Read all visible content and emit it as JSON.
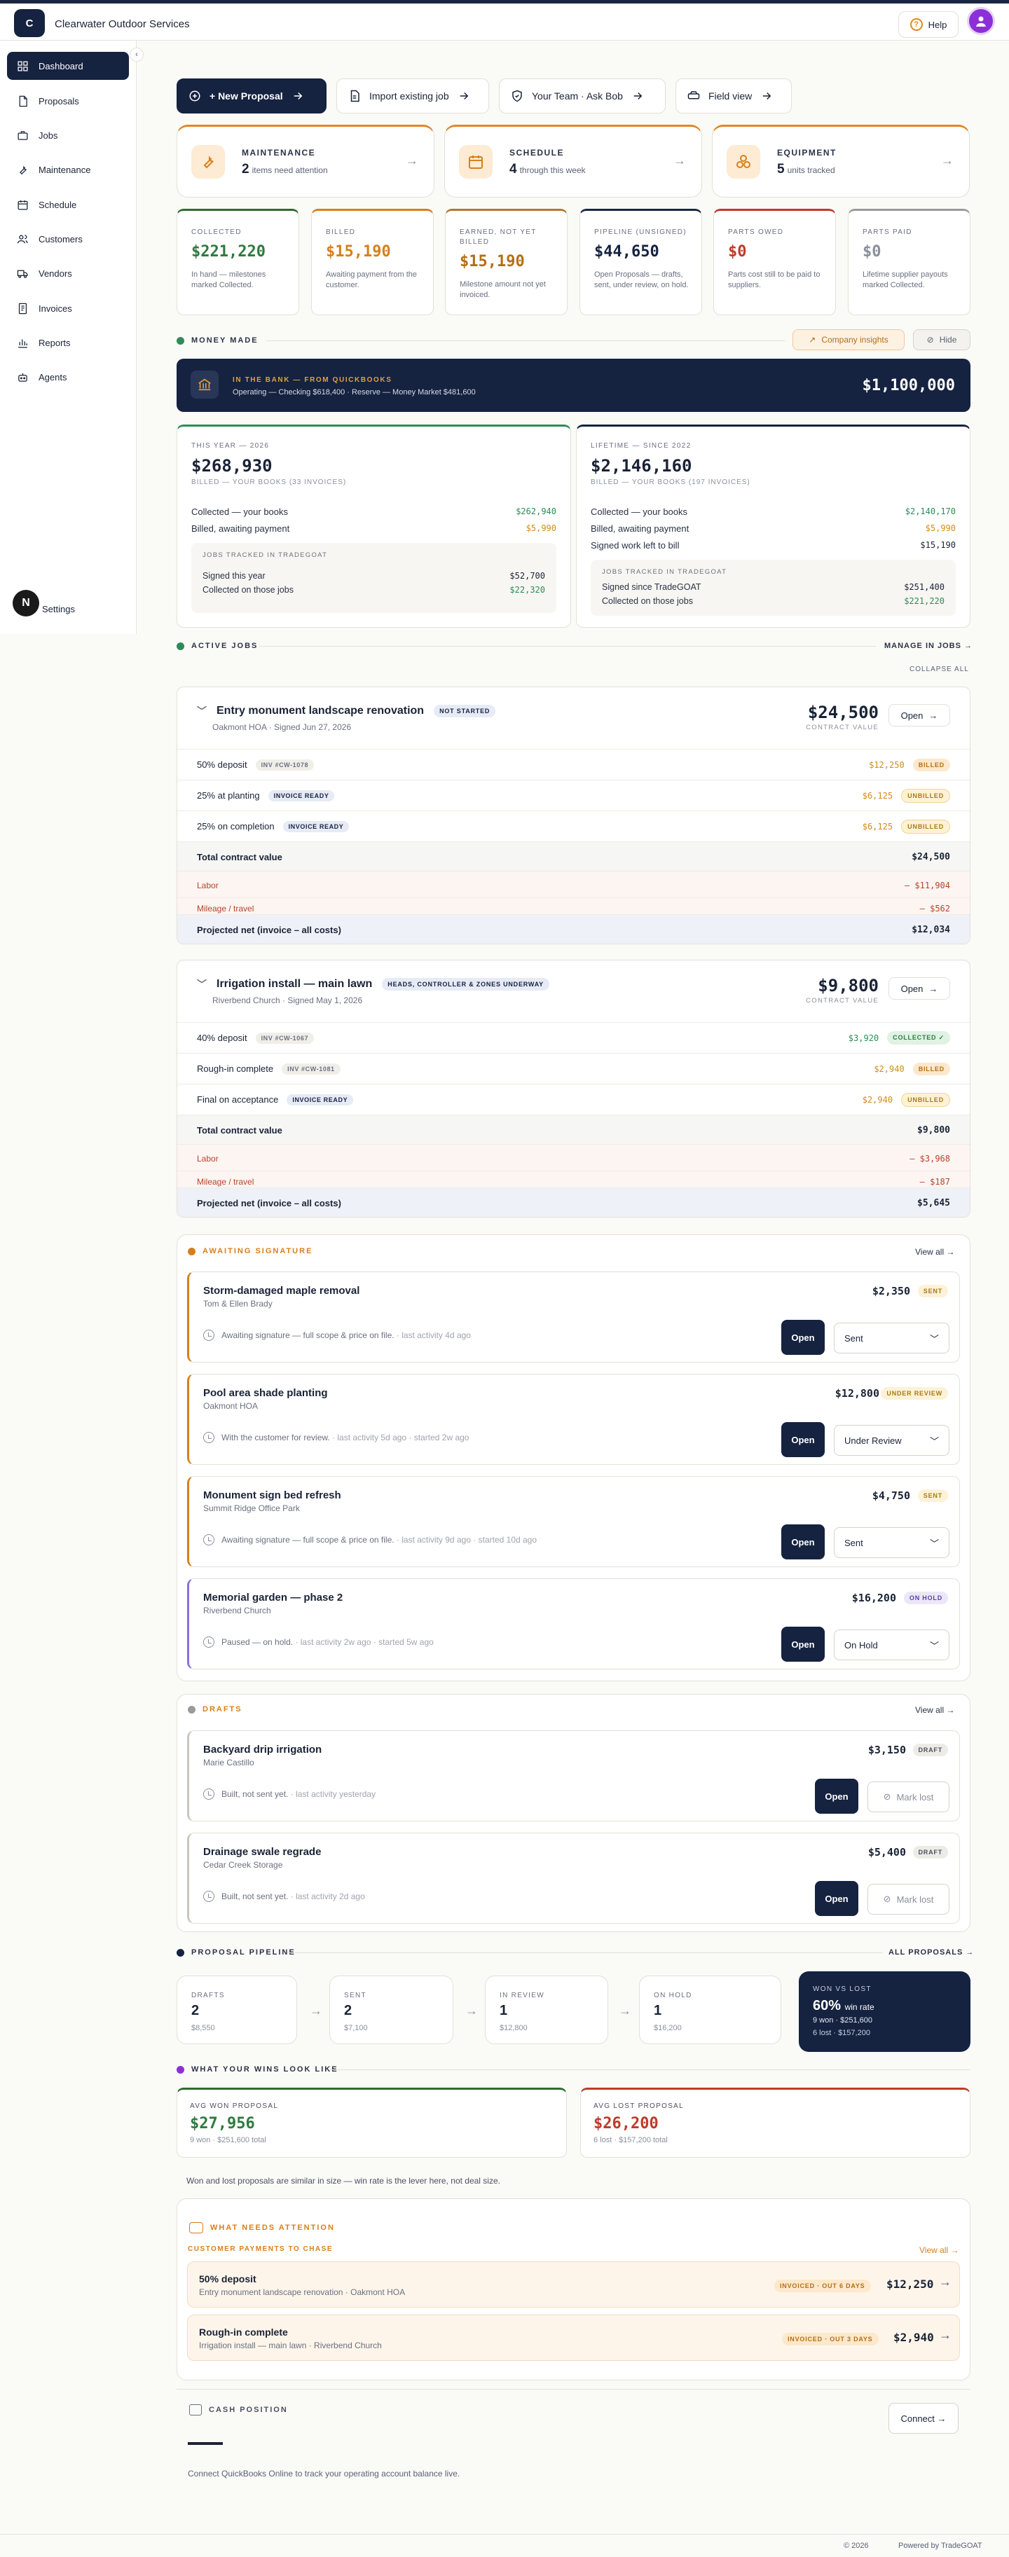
{
  "app": {
    "brand": "Clearwater Outdoor Services",
    "logo_letter": "C",
    "help": "Help"
  },
  "sidebar": {
    "items": [
      {
        "label": "Dashboard"
      },
      {
        "label": "Proposals"
      },
      {
        "label": "Jobs"
      },
      {
        "label": "Maintenance"
      },
      {
        "label": "Schedule"
      },
      {
        "label": "Customers"
      },
      {
        "label": "Vendors"
      },
      {
        "label": "Invoices"
      },
      {
        "label": "Reports"
      },
      {
        "label": "Agents"
      }
    ],
    "badge": "N",
    "settings": "Settings"
  },
  "actions": {
    "new_proposal": "+ New Proposal",
    "import": "Import existing job",
    "team": "Your Team · Ask Bob",
    "field": "Field view"
  },
  "tiles": [
    {
      "label": "MAINTENANCE",
      "value": "2",
      "desc": "items need attention"
    },
    {
      "label": "SCHEDULE",
      "value": "4",
      "desc": "through this week"
    },
    {
      "label": "EQUIPMENT",
      "value": "5",
      "desc": "units tracked"
    }
  ],
  "kpis": [
    {
      "label": "COLLECTED",
      "value": "$221,220",
      "desc": "In hand — milestones marked Collected."
    },
    {
      "label": "BILLED",
      "value": "$15,190",
      "desc": "Awaiting payment from the customer."
    },
    {
      "label": "EARNED, NOT YET BILLED",
      "value": "$15,190",
      "desc": "Milestone amount not yet invoiced."
    },
    {
      "label": "PIPELINE (UNSIGNED)",
      "value": "$44,650",
      "desc": "Open Proposals — drafts, sent, under review, on hold."
    },
    {
      "label": "PARTS OWED",
      "value": "$0",
      "desc": "Parts cost still to be paid to suppliers."
    },
    {
      "label": "PARTS PAID",
      "value": "$0",
      "desc": "Lifetime supplier payouts marked Collected."
    }
  ],
  "money": {
    "title": "MONEY MADE",
    "insights": "Company insights",
    "hide": "Hide",
    "bank_label": "IN THE BANK — FROM QUICKBOOKS",
    "bank_detail": "Operating — Checking $618,400 · Reserve — Money Market $481,600",
    "bank_total": "$1,100,000",
    "year": {
      "label": "THIS YEAR — 2026",
      "value": "$268,930",
      "sub": "BILLED — YOUR BOOKS (33 INVOICES)",
      "r1l": "Collected — your books",
      "r1v": "$262,940",
      "r2l": "Billed, awaiting payment",
      "r2v": "$5,990",
      "box_label": "JOBS TRACKED IN TRADEGOAT",
      "b1l": "Signed this year",
      "b1v": "$52,700",
      "b2l": "Collected on those jobs",
      "b2v": "$22,320"
    },
    "life": {
      "label": "LIFETIME — SINCE 2022",
      "value": "$2,146,160",
      "sub": "BILLED — YOUR BOOKS (197 INVOICES)",
      "r1l": "Collected — your books",
      "r1v": "$2,140,170",
      "r2l": "Billed, awaiting payment",
      "r2v": "$5,990",
      "r3l": "Signed work left to bill",
      "r3v": "$15,190",
      "box_label": "JOBS TRACKED IN TRADEGOAT",
      "b1l": "Signed since TradeGOAT",
      "b1v": "$251,400",
      "b2l": "Collected on those jobs",
      "b2v": "$221,220"
    }
  },
  "active": {
    "title": "ACTIVE JOBS",
    "manage": "MANAGE IN JOBS →",
    "collapse": "COLLAPSE ALL"
  },
  "jobs": [
    {
      "title": "Entry monument landscape renovation",
      "status": "NOT STARTED",
      "meta": "Oakmont HOA · Signed Jun 27, 2026",
      "amount": "$24,500",
      "amount_label": "CONTRACT VALUE",
      "open": "Open",
      "rows": [
        {
          "label": "50% deposit",
          "tag": "INV #CW-1078",
          "value": "$12,250",
          "pill": "BILLED"
        },
        {
          "label": "25% at planting",
          "tag": "INVOICE READY",
          "value": "$6,125",
          "pill": "UNBILLED"
        },
        {
          "label": "25% on completion",
          "tag": "INVOICE READY",
          "value": "$6,125",
          "pill": "UNBILLED"
        }
      ],
      "total_label": "Total contract value",
      "total": "$24,500",
      "labor_label": "Labor",
      "labor": "– $11,904",
      "mileage_label": "Mileage / travel",
      "mileage": "– $562",
      "net_label": "Projected net (invoice – all costs)",
      "net": "$12,034"
    },
    {
      "title": "Irrigation install — main lawn",
      "status": "HEADS, CONTROLLER & ZONES UNDERWAY",
      "meta": "Riverbend Church · Signed May 1, 2026",
      "amount": "$9,800",
      "amount_label": "CONTRACT VALUE",
      "open": "Open",
      "rows": [
        {
          "label": "40% deposit",
          "tag": "INV #CW-1067",
          "value": "$3,920",
          "pill": "COLLECTED ✓"
        },
        {
          "label": "Rough-in complete",
          "tag": "INV #CW-1081",
          "value": "$2,940",
          "pill": "BILLED"
        },
        {
          "label": "Final on acceptance",
          "tag": "INVOICE READY",
          "value": "$2,940",
          "pill": "UNBILLED"
        }
      ],
      "total_label": "Total contract value",
      "total": "$9,800",
      "labor_label": "Labor",
      "labor": "– $3,968",
      "mileage_label": "Mileage / travel",
      "mileage": "– $187",
      "net_label": "Projected net (invoice – all costs)",
      "net": "$5,645"
    }
  ],
  "awaiting": {
    "title": "AWAITING SIGNATURE",
    "view_all": "View all →",
    "cards": [
      {
        "title": "Storm-damaged maple removal",
        "client": "Tom & Ellen Brady",
        "meta": "Awaiting signature — full scope & price on file.",
        "activity": " · last activity 4d ago",
        "amount": "$2,350",
        "pill": "SENT",
        "open": "Open",
        "select": "Sent"
      },
      {
        "title": "Pool area shade planting",
        "client": "Oakmont HOA",
        "meta": "With the customer for review.",
        "activity": " · last activity 5d ago · started 2w ago",
        "amount": "$12,800",
        "pill": "UNDER REVIEW",
        "open": "Open",
        "select": "Under Review"
      },
      {
        "title": "Monument sign bed refresh",
        "client": "Summit Ridge Office Park",
        "meta": "Awaiting signature — full scope & price on file.",
        "activity": " · last activity 9d ago · started 10d ago",
        "amount": "$4,750",
        "pill": "SENT",
        "open": "Open",
        "select": "Sent"
      },
      {
        "title": "Memorial garden — phase 2",
        "client": "Riverbend Church",
        "meta": "Paused — on hold.",
        "activity": " · last activity 2w ago · started 5w ago",
        "amount": "$16,200",
        "pill": "ON HOLD",
        "open": "Open",
        "select": "On Hold"
      }
    ]
  },
  "drafts": {
    "title": "DRAFTS",
    "view_all": "View all →",
    "cards": [
      {
        "title": "Backyard drip irrigation",
        "client": "Marie Castillo",
        "meta": "Built, not sent yet.",
        "activity": " · last activity yesterday",
        "amount": "$3,150",
        "pill": "DRAFT",
        "open": "Open",
        "lost": "Mark lost"
      },
      {
        "title": "Drainage swale regrade",
        "client": "Cedar Creek Storage",
        "meta": "Built, not sent yet.",
        "activity": " · last activity 2d ago",
        "amount": "$5,400",
        "pill": "DRAFT",
        "open": "Open",
        "lost": "Mark lost"
      }
    ]
  },
  "pipeline": {
    "title": "PROPOSAL PIPELINE",
    "all": "ALL PROPOSALS →",
    "stages": [
      {
        "label": "DRAFTS",
        "count": "2",
        "amount": "$8,550"
      },
      {
        "label": "SENT",
        "count": "2",
        "amount": "$7,100"
      },
      {
        "label": "IN REVIEW",
        "count": "1",
        "amount": "$12,800"
      },
      {
        "label": "ON HOLD",
        "count": "1",
        "amount": "$16,200"
      }
    ],
    "wl_label": "WON VS LOST",
    "wl_rate": "60%",
    "wl_rate_label": "win rate",
    "wl_won": "9 won · $251,600",
    "wl_lost": "6 lost · $157,200"
  },
  "wins": {
    "title": "WHAT YOUR WINS LOOK LIKE",
    "won_label": "AVG WON PROPOSAL",
    "won_value": "$27,956",
    "won_sub": "9 won · $251,600 total",
    "lost_label": "AVG LOST PROPOSAL",
    "lost_value": "$26,200",
    "lost_sub": "6 lost · $157,200 total",
    "note": "Won and lost proposals are similar in size — win rate is the lever here, not deal size."
  },
  "attention": {
    "title": "WHAT NEEDS ATTENTION",
    "sub": "CUSTOMER PAYMENTS TO CHASE",
    "view_all": "View all →",
    "items": [
      {
        "title": "50% deposit",
        "desc": "Entry monument landscape renovation · Oakmont HOA",
        "pill": "INVOICED · OUT 6 DAYS",
        "amount": "$12,250"
      },
      {
        "title": "Rough-in complete",
        "desc": "Irrigation install — main lawn · Riverbend Church",
        "pill": "INVOICED · OUT 3 DAYS",
        "amount": "$2,940"
      }
    ]
  },
  "cash": {
    "title": "CASH POSITION",
    "connect": "Connect →",
    "note": "Connect QuickBooks Online to track your operating account balance live."
  },
  "footer": {
    "copy": "© 2026",
    "powered": "Powered by TradeGOAT"
  },
  "colors": {
    "navy": "#152240",
    "orange": "#d77f1c",
    "green": "#2e8b57",
    "red": "#c0392b",
    "purple": "#8c2fd9"
  }
}
